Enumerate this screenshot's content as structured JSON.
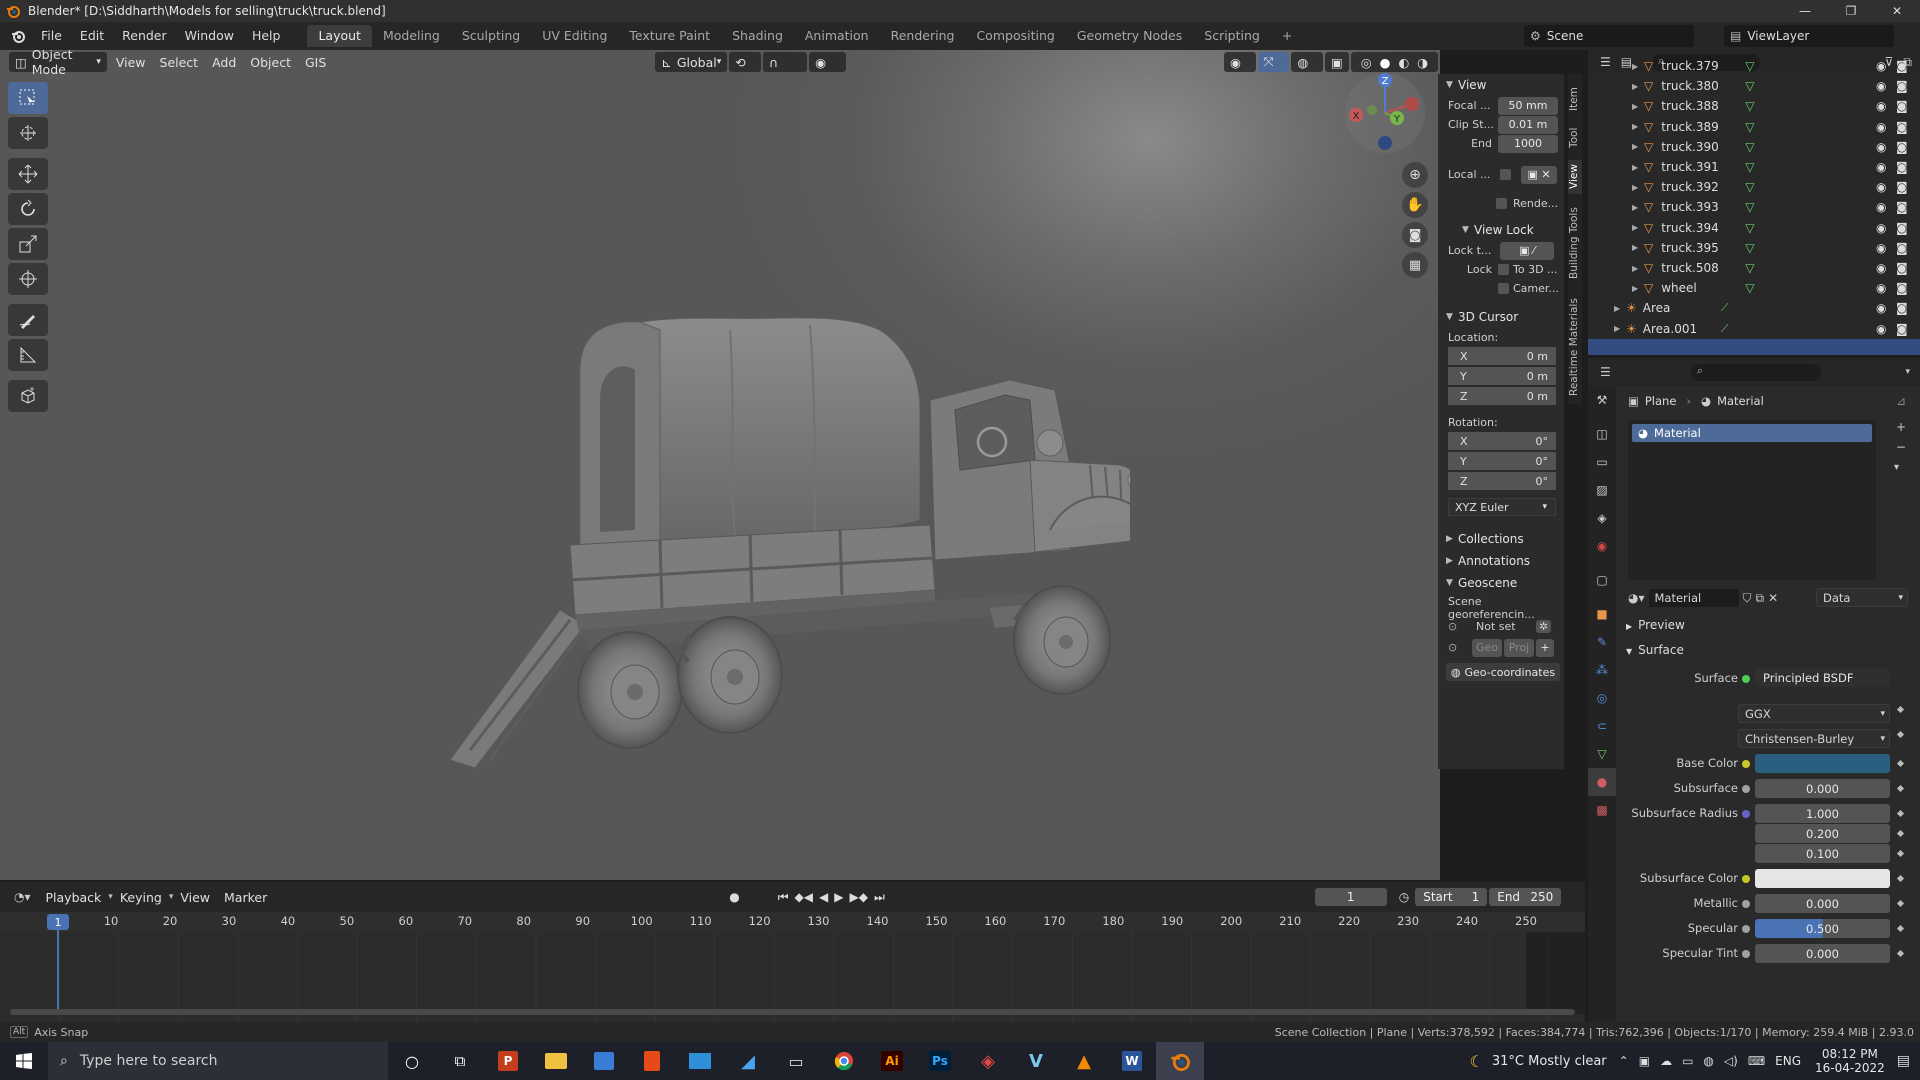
{
  "window": {
    "title": "Blender* [D:\\Siddharth\\Models for selling\\truck\\truck.blend]",
    "minimize": "—",
    "maximize": "❐",
    "close": "✕"
  },
  "menu": {
    "items": [
      "File",
      "Edit",
      "Render",
      "Window",
      "Help"
    ]
  },
  "workspaces": {
    "tabs": [
      "Layout",
      "Modeling",
      "Sculpting",
      "UV Editing",
      "Texture Paint",
      "Shading",
      "Animation",
      "Rendering",
      "Compositing",
      "Geometry Nodes",
      "Scripting"
    ],
    "active": "Layout",
    "add": "+"
  },
  "scene": {
    "name": "Scene",
    "view_layer": "ViewLayer"
  },
  "viewport_header": {
    "mode": "Object Mode",
    "menus": [
      "View",
      "Select",
      "Add",
      "Object",
      "GIS"
    ],
    "orientation": "Global"
  },
  "n_panel": {
    "view": {
      "header": "View",
      "focal_label": "Focal ...",
      "focal_value": "50 mm",
      "clip_start_label": "Clip St...",
      "clip_start_value": "0.01 m",
      "end_label": "End",
      "end_value": "1000",
      "local_label": "Local ...",
      "render_label": "Rende..."
    },
    "view_lock": {
      "header": "View Lock",
      "lock_to_label": "Lock t...",
      "lock_label": "Lock",
      "to_3d_label": "To 3D ...",
      "camera_label": "Camer..."
    },
    "cursor": {
      "header": "3D Cursor",
      "location_label": "Location:",
      "location": [
        {
          "axis": "X",
          "value": "0 m"
        },
        {
          "axis": "Y",
          "value": "0 m"
        },
        {
          "axis": "Z",
          "value": "0 m"
        }
      ],
      "rotation_label": "Rotation:",
      "rotation": [
        {
          "axis": "X",
          "value": "0°"
        },
        {
          "axis": "Y",
          "value": "0°"
        },
        {
          "axis": "Z",
          "value": "0°"
        }
      ],
      "rotation_mode": "XYZ Euler"
    },
    "collections": "Collections",
    "annotations": "Annotations",
    "geoscene": {
      "header": "Geoscene",
      "georef_label": "Scene georeferencin...",
      "not_set": "Not set",
      "geo_btn": "Geo",
      "proj_btn": "Proj",
      "coords_btn": "Geo-coordinates"
    }
  },
  "side_tabs": [
    "Item",
    "Tool",
    "View",
    "Building Tools",
    "Realtime Materials"
  ],
  "outliner": {
    "rows": [
      {
        "name": "truck.379",
        "kind": "mesh"
      },
      {
        "name": "truck.380",
        "kind": "mesh"
      },
      {
        "name": "truck.388",
        "kind": "mesh"
      },
      {
        "name": "truck.389",
        "kind": "mesh"
      },
      {
        "name": "truck.390",
        "kind": "mesh"
      },
      {
        "name": "truck.391",
        "kind": "mesh"
      },
      {
        "name": "truck.392",
        "kind": "mesh"
      },
      {
        "name": "truck.393",
        "kind": "mesh"
      },
      {
        "name": "truck.394",
        "kind": "mesh"
      },
      {
        "name": "truck.395",
        "kind": "mesh"
      },
      {
        "name": "truck.508",
        "kind": "mesh"
      },
      {
        "name": "wheel",
        "kind": "mesh"
      },
      {
        "name": "Area",
        "kind": "light"
      },
      {
        "name": "Area.001",
        "kind": "light"
      }
    ]
  },
  "properties": {
    "breadcrumb_object": "Plane",
    "breadcrumb_material": "Material",
    "slot_name": "Material",
    "material_name": "Material",
    "link_mode": "Data",
    "preview_label": "Preview",
    "surface_section": "Surface",
    "surface_label": "Surface",
    "surface_shader": "Principled BSDF",
    "distribution": "GGX",
    "subsurface_method": "Christensen-Burley",
    "fields": [
      {
        "label": "Base Color",
        "value": "",
        "color": "#2a5f80"
      },
      {
        "label": "Subsurface",
        "value": "0.000"
      },
      {
        "label": "Subsurface Radius",
        "value": "1.000"
      },
      {
        "label": "",
        "value": "0.200"
      },
      {
        "label": "",
        "value": "0.100"
      },
      {
        "label": "Subsurface Color",
        "value": "",
        "color": "#e6e6e6"
      },
      {
        "label": "Metallic",
        "value": "0.000"
      },
      {
        "label": "Specular",
        "value": "0.500",
        "fill": 0.5
      },
      {
        "label": "Specular Tint",
        "value": "0.000"
      }
    ]
  },
  "timeline": {
    "menus": [
      "Playback",
      "Keying",
      "View",
      "Marker"
    ],
    "current_frame": "1",
    "start_label": "Start",
    "start": "1",
    "end_label": "End",
    "end": "250",
    "ticks": [
      "1",
      "10",
      "20",
      "30",
      "40",
      "50",
      "60",
      "70",
      "80",
      "90",
      "100",
      "110",
      "120",
      "130",
      "140",
      "150",
      "160",
      "170",
      "180",
      "190",
      "200",
      "210",
      "220",
      "230",
      "240",
      "250"
    ]
  },
  "status": {
    "key_hint": "Alt",
    "hint": "Axis Snap",
    "stats": "Scene Collection | Plane | Verts:378,592 | Faces:384,774 | Tris:762,396 | Objects:1/170 | Memory: 259.4 MiB | 2.93.0"
  },
  "taskbar": {
    "search_placeholder": "Type here to search",
    "apps": [
      "cortana",
      "task-view",
      "powerpoint",
      "file-explorer",
      "store",
      "office",
      "mail",
      "azure-data-studio",
      "remote-desktop",
      "chrome",
      "illustrator",
      "photoshop",
      "sketchup",
      "vray",
      "vlc",
      "word",
      "blender"
    ],
    "weather": "31°C  Mostly clear",
    "language": "ENG",
    "time": "08:12 PM",
    "date": "16-04-2022"
  },
  "colors": {
    "accent": "#4d6a98",
    "header": "#262626",
    "panel": "#2b2b2b",
    "viewport": "#5f5f5f",
    "mesh_icon": "#e8964a",
    "data_icon": "#6bd16b",
    "frame": "#4a73b5"
  }
}
